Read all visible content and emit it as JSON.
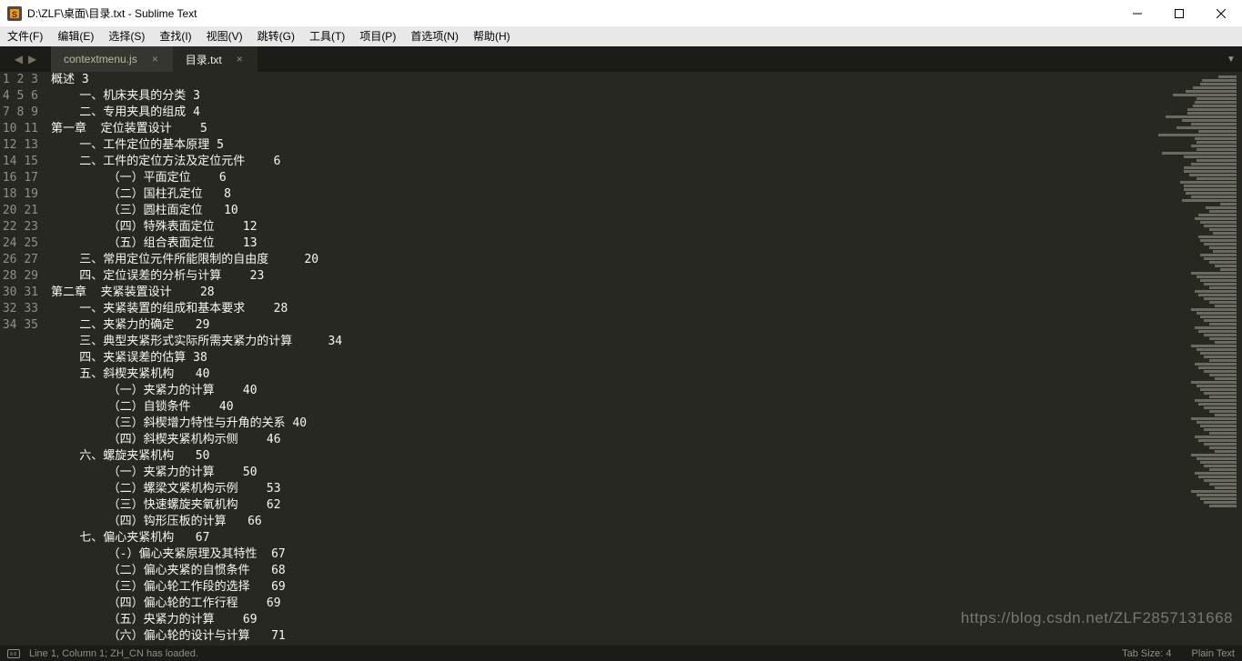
{
  "window": {
    "title": "D:\\ZLF\\桌面\\目录.txt - Sublime Text"
  },
  "menu": {
    "items": [
      "文件(F)",
      "编辑(E)",
      "选择(S)",
      "查找(I)",
      "视图(V)",
      "跳转(G)",
      "工具(T)",
      "项目(P)",
      "首选项(N)",
      "帮助(H)"
    ]
  },
  "tabs": [
    {
      "label": "contextmenu.js",
      "active": false
    },
    {
      "label": "目录.txt",
      "active": true
    }
  ],
  "lines": [
    "概述 3",
    "    一、机床夹具的分类 3",
    "    二、专用夹具的组成 4",
    "第一章  定位装置设计    5",
    "    一、工件定位的基本原理 5",
    "    二、工件的定位方法及定位元件    6",
    "        （一）平面定位    6",
    "        （二）国柱孔定位   8",
    "        （三）圆柱面定位   10",
    "        （四）特殊表面定位    12",
    "        （五）组合表面定位    13",
    "    三、常用定位元件所能限制的自由度     20",
    "    四、定位误差的分析与计算    23",
    "第二章  夹紧装置设计    28",
    "    一、夹紧装置的组成和基本要求    28",
    "    二、夹紧力的确定   29",
    "    三、典型夹紧形式实际所需夹紧力的计算     34",
    "    四、夹紧误差的估算 38",
    "    五、斜楔夹紧机构   40",
    "        （一）夹紧力的计算    40",
    "        （二）自锁条件    40",
    "        （三）斜楔增力特性与升角的关系 40",
    "        （四）斜楔夹紧机构示侧    46",
    "    六、螺旋夹紧机构   50",
    "        （一）夹紧力的计算    50",
    "        （二）螺梁文紧机构示例    53",
    "        （三）快速螺旋夹氧机构    62",
    "        （四）钩形压板的计算   66",
    "    七、偏心夹紧机构   67",
    "        （-）偏心夹紧原理及其特性  67",
    "        （二）偏心夹紧的自惯条件   68",
    "        （三）偏心轮工作段的选择   69",
    "        （四）偏心轮的工作行程    69",
    "        （五）央紧力的计算    69",
    "        （六）偏心轮的设计与计算   71"
  ],
  "status": {
    "left": "Line 1, Column 1; ZH_CN has loaded.",
    "tab_size": "Tab Size: 4",
    "syntax": "Plain Text"
  },
  "watermark": "https://blog.csdn.net/ZLF2857131668"
}
